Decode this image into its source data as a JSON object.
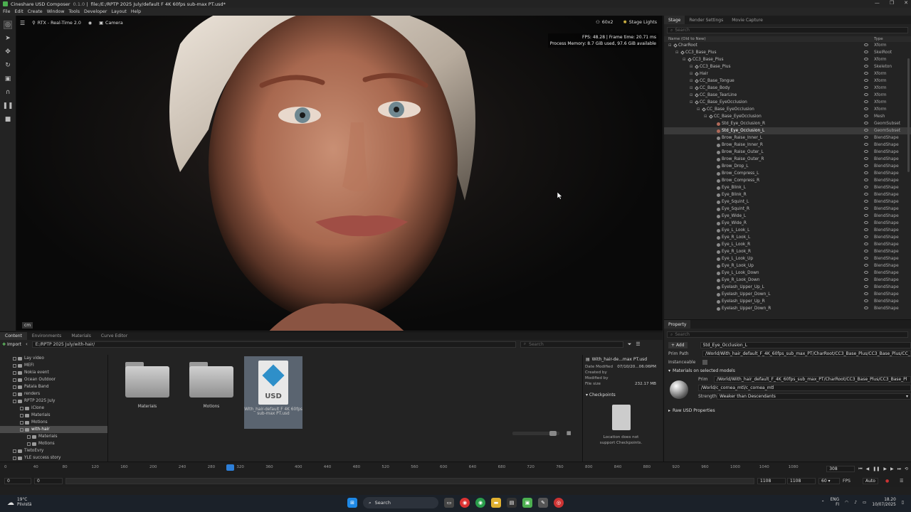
{
  "window": {
    "app_name": "Cineshare USD Composer",
    "version": "0.1.0",
    "file": "file:/E:/RPTP 2025 July/default F 4K 60fps sub-max PT.usd*",
    "controls": [
      "—",
      "❐",
      "✕"
    ]
  },
  "menu": [
    "File",
    "Edit",
    "Create",
    "Window",
    "Tools",
    "Developer",
    "Layout",
    "Help"
  ],
  "viewport": {
    "renderer": "RTX - Real-Time 2.0",
    "camera": "Camera",
    "resolution": "60x2",
    "stage_lights": "Stage Lights",
    "perf_line1": "FPS: 48.28 | Frame time: 20.71 ms",
    "perf_line2": "Process Memory: 8.7 GiB used, 97.6 GiB available",
    "unit": "cm"
  },
  "stage": {
    "tabs": [
      "Stage",
      "Render Settings",
      "Movie Capture"
    ],
    "search_placeholder": "Search",
    "col_name": "Name (Old to New)",
    "col_type": "Type",
    "rows": [
      {
        "name": "CharRoot",
        "type": "Xform",
        "depth": 3,
        "icon": "x"
      },
      {
        "name": "CC3_Base_Plus",
        "type": "SkelRoot",
        "depth": 4,
        "icon": "x"
      },
      {
        "name": "CC3_Base_Plus",
        "type": "Xform",
        "depth": 5,
        "icon": "x"
      },
      {
        "name": "CC3_Base_Plus",
        "type": "Skeleton",
        "depth": 6,
        "icon": "x"
      },
      {
        "name": "Hair",
        "type": "Xform",
        "depth": 6,
        "icon": "x"
      },
      {
        "name": "CC_Base_Tongue",
        "type": "Xform",
        "depth": 6,
        "icon": "x"
      },
      {
        "name": "CC_Base_Body",
        "type": "Xform",
        "depth": 6,
        "icon": "x"
      },
      {
        "name": "CC_Base_TearLine",
        "type": "Xform",
        "depth": 6,
        "icon": "x"
      },
      {
        "name": "CC_Base_EyeOcclusion",
        "type": "Xform",
        "depth": 6,
        "icon": "x"
      },
      {
        "name": "CC_Base_EyeOcclusion",
        "type": "Xform",
        "depth": 7,
        "icon": "x"
      },
      {
        "name": "CC_Base_EyeOcclusion",
        "type": "Mesh",
        "depth": 8,
        "icon": "x"
      },
      {
        "name": "Std_Eye_Occlusion_R",
        "type": "GeomSubset",
        "depth": 9,
        "icon": "g"
      },
      {
        "name": "Std_Eye_Occlusion_L",
        "type": "GeomSubset",
        "depth": 9,
        "icon": "g",
        "selected": true
      },
      {
        "name": "Brow_Raise_Inner_L",
        "type": "BlendShape",
        "depth": 9,
        "icon": "b"
      },
      {
        "name": "Brow_Raise_Inner_R",
        "type": "BlendShape",
        "depth": 9,
        "icon": "b"
      },
      {
        "name": "Brow_Raise_Outer_L",
        "type": "BlendShape",
        "depth": 9,
        "icon": "b"
      },
      {
        "name": "Brow_Raise_Outer_R",
        "type": "BlendShape",
        "depth": 9,
        "icon": "b"
      },
      {
        "name": "Brow_Drop_L",
        "type": "BlendShape",
        "depth": 9,
        "icon": "b"
      },
      {
        "name": "Brow_Compress_L",
        "type": "BlendShape",
        "depth": 9,
        "icon": "b"
      },
      {
        "name": "Brow_Compress_R",
        "type": "BlendShape",
        "depth": 9,
        "icon": "b"
      },
      {
        "name": "Eye_Blink_L",
        "type": "BlendShape",
        "depth": 9,
        "icon": "b"
      },
      {
        "name": "Eye_Blink_R",
        "type": "BlendShape",
        "depth": 9,
        "icon": "b"
      },
      {
        "name": "Eye_Squint_L",
        "type": "BlendShape",
        "depth": 9,
        "icon": "b"
      },
      {
        "name": "Eye_Squint_R",
        "type": "BlendShape",
        "depth": 9,
        "icon": "b"
      },
      {
        "name": "Eye_Wide_L",
        "type": "BlendShape",
        "depth": 9,
        "icon": "b"
      },
      {
        "name": "Eye_Wide_R",
        "type": "BlendShape",
        "depth": 9,
        "icon": "b"
      },
      {
        "name": "Eye_L_Look_L",
        "type": "BlendShape",
        "depth": 9,
        "icon": "b"
      },
      {
        "name": "Eye_R_Look_L",
        "type": "BlendShape",
        "depth": 9,
        "icon": "b"
      },
      {
        "name": "Eye_L_Look_R",
        "type": "BlendShape",
        "depth": 9,
        "icon": "b"
      },
      {
        "name": "Eye_R_Look_R",
        "type": "BlendShape",
        "depth": 9,
        "icon": "b"
      },
      {
        "name": "Eye_L_Look_Up",
        "type": "BlendShape",
        "depth": 9,
        "icon": "b"
      },
      {
        "name": "Eye_R_Look_Up",
        "type": "BlendShape",
        "depth": 9,
        "icon": "b"
      },
      {
        "name": "Eye_L_Look_Down",
        "type": "BlendShape",
        "depth": 9,
        "icon": "b"
      },
      {
        "name": "Eye_R_Look_Down",
        "type": "BlendShape",
        "depth": 9,
        "icon": "b"
      },
      {
        "name": "Eyelash_Upper_Up_L",
        "type": "BlendShape",
        "depth": 9,
        "icon": "b"
      },
      {
        "name": "Eyelash_Upper_Down_L",
        "type": "BlendShape",
        "depth": 9,
        "icon": "b"
      },
      {
        "name": "Eyelash_Upper_Up_R",
        "type": "BlendShape",
        "depth": 9,
        "icon": "b"
      },
      {
        "name": "Eyelash_Upper_Down_R",
        "type": "BlendShape",
        "depth": 9,
        "icon": "b"
      }
    ]
  },
  "property": {
    "tab": "Property",
    "search_placeholder": "Search",
    "add_label": "Add",
    "name_value": "Std_Eye_Occlusion_L",
    "prim_path_label": "Prim Path",
    "prim_path_value": "/World/With_hair_default_F_4K_60fps_sub_max_PT/CharRoot/CC3_Base_Plus/CC3_Base_Plus/CC_Ba",
    "instanceable_label": "Instanceable",
    "materials_section": "Materials on selected models",
    "prim_label": "Prim",
    "prim_value": "/World/With_hair_default_F_4K_60fps_sub_max_PT/CharRoot/CC3_Base_Plus/CC3_Base_Pl",
    "material_value": "/World/c_cornea_mtl/c_cornea_mtl",
    "strength_label": "Strength",
    "strength_value": "Weaker than Descendants",
    "raw_section": "Raw USD Properties"
  },
  "content": {
    "tabs": [
      "Content",
      "Environments",
      "Materials",
      "Curve Editor"
    ],
    "import_label": "Import",
    "path": "E:/RPTP 2025 July/with-hair/",
    "search_placeholder": "Search",
    "tree": [
      {
        "name": "Lay video",
        "depth": 1
      },
      {
        "name": "MEFI",
        "depth": 1
      },
      {
        "name": "Nokia event",
        "depth": 1
      },
      {
        "name": "Ocean Outdoor",
        "depth": 1
      },
      {
        "name": "Patala Band",
        "depth": 1
      },
      {
        "name": "renders",
        "depth": 1
      },
      {
        "name": "RPTP 2025 July",
        "depth": 1
      },
      {
        "name": "iClone",
        "depth": 2
      },
      {
        "name": "Materials",
        "depth": 2
      },
      {
        "name": "Motions",
        "depth": 2
      },
      {
        "name": "with-hair",
        "depth": 2,
        "selected": true
      },
      {
        "name": "Materials",
        "depth": 3
      },
      {
        "name": "Motions",
        "depth": 3
      },
      {
        "name": "TietoEvry",
        "depth": 1
      },
      {
        "name": "YLE success story",
        "depth": 1
      }
    ],
    "assets": [
      {
        "label": "Materials",
        "kind": "folder"
      },
      {
        "label": "Motions",
        "kind": "folder"
      },
      {
        "label": "With_hair-default F 4K 60fps sub-max PT.usd",
        "kind": "usd"
      }
    ],
    "info": {
      "title": "With_hair-de...max PT.usd",
      "date_modified_label": "Date Modified",
      "date_modified_value": "07/10/20...06:06PM",
      "created_by_label": "Created by",
      "modified_by_label": "Modified by",
      "file_size_label": "File size",
      "file_size_value": "232.17 MB",
      "checkpoints_label": "Checkpoints",
      "checkpoints_msg1": "Location does not",
      "checkpoints_msg2": "support Checkpoints."
    }
  },
  "timeline": {
    "ticks": [
      "0",
      "40",
      "80",
      "120",
      "160",
      "200",
      "240",
      "280",
      "320",
      "360",
      "400",
      "440",
      "480",
      "520",
      "560",
      "600",
      "640",
      "680",
      "720",
      "760",
      "800",
      "840",
      "880",
      "920",
      "960",
      "1000",
      "1040",
      "1080"
    ],
    "current_frame": "308",
    "start_a": "0",
    "start_b": "0",
    "end_a": "1108",
    "end_b": "1108",
    "fps_value": "60",
    "fps_label": "FPS",
    "mode": "Auto"
  },
  "taskbar": {
    "temp": "19°C",
    "weather": "Pilvistä",
    "search": "Search",
    "lang1": "ENG",
    "lang2": "FI",
    "time": "18.20",
    "date": "10/07/2025"
  }
}
